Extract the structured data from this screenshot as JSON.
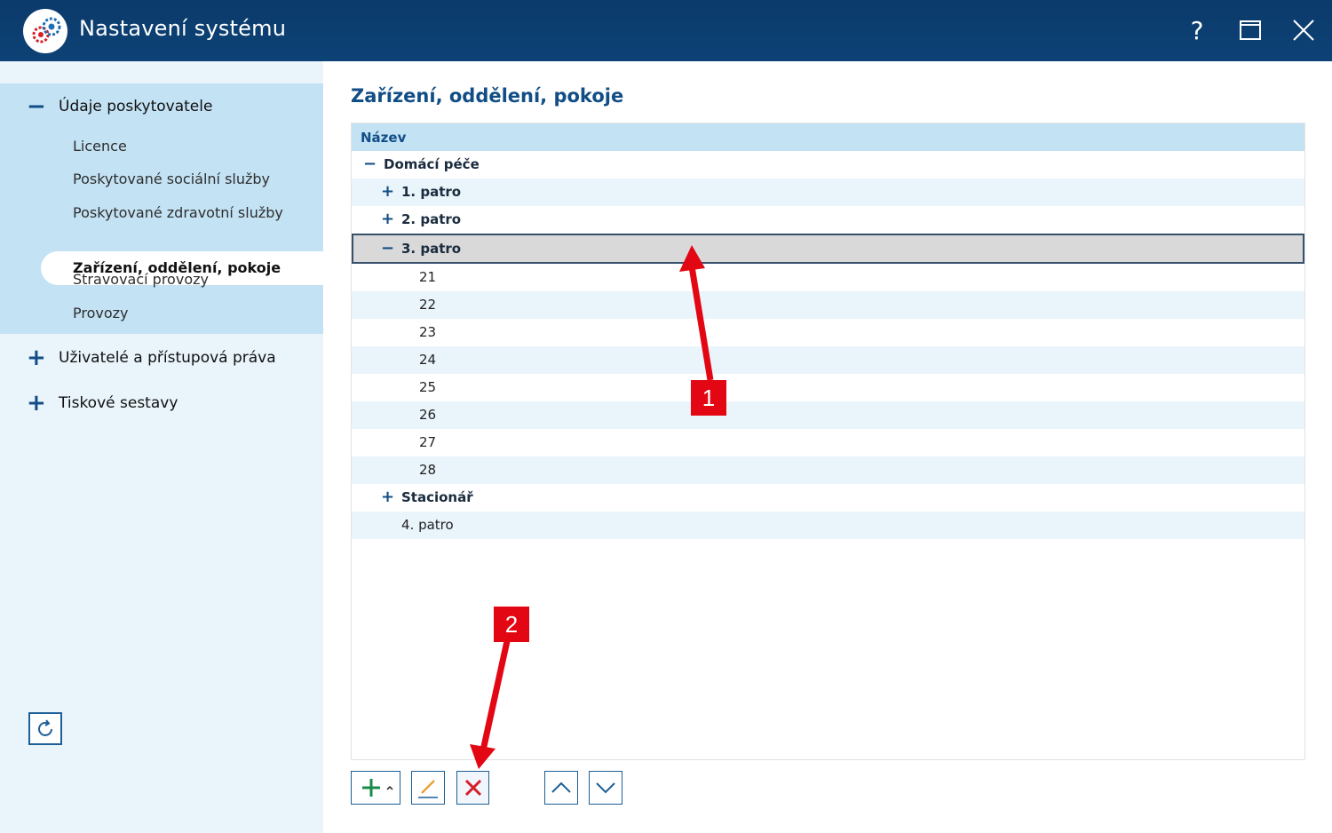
{
  "window": {
    "title": "Nastavení systému",
    "help_label": "?"
  },
  "sidebar": {
    "groups": [
      {
        "label": "Údaje poskytovatele",
        "expanded": true,
        "items": [
          {
            "label": "Licence"
          },
          {
            "label": "Poskytované sociální služby"
          },
          {
            "label": "Poskytované zdravotní služby"
          },
          {
            "label": "Zařízení, oddělení, pokoje",
            "active": true
          },
          {
            "label": "Stravovací provozy"
          },
          {
            "label": "Provozy"
          }
        ]
      },
      {
        "label": "Uživatelé a přístupová práva",
        "expanded": false
      },
      {
        "label": "Tiskové sestavy",
        "expanded": false
      }
    ]
  },
  "main": {
    "title": "Zařízení, oddělení, pokoje",
    "grid": {
      "column_header": "Název",
      "rows": [
        {
          "label": "Domácí péče",
          "level": 0,
          "expander": "−",
          "bold": true
        },
        {
          "label": "1. patro",
          "level": 1,
          "expander": "+",
          "bold": true
        },
        {
          "label": "2. patro",
          "level": 1,
          "expander": "+",
          "bold": true
        },
        {
          "label": "3. patro",
          "level": 1,
          "expander": "−",
          "bold": true,
          "selected": true
        },
        {
          "label": "21",
          "level": 2
        },
        {
          "label": "22",
          "level": 2
        },
        {
          "label": "23",
          "level": 2
        },
        {
          "label": "24",
          "level": 2
        },
        {
          "label": "25",
          "level": 2
        },
        {
          "label": "26",
          "level": 2
        },
        {
          "label": "27",
          "level": 2
        },
        {
          "label": "28",
          "level": 2
        },
        {
          "label": "Stacionář",
          "level": 1,
          "expander": "+",
          "bold": true
        },
        {
          "label": "4. patro",
          "level": 1
        }
      ]
    },
    "toolbar": {
      "buttons": [
        "add-icon",
        "edit-icon",
        "delete-icon",
        "move-up-icon",
        "move-down-icon"
      ]
    }
  },
  "annotations": [
    {
      "number": "1"
    },
    {
      "number": "2"
    }
  ],
  "colors": {
    "titlebar": "#0b3a6b",
    "accent": "#124e86",
    "sidebar_bg": "#e9f4fb",
    "sidebar_group_bg": "#c3e2f4",
    "marker": "#e30613",
    "delete": "#d4202a",
    "add": "#1a8a4a"
  }
}
